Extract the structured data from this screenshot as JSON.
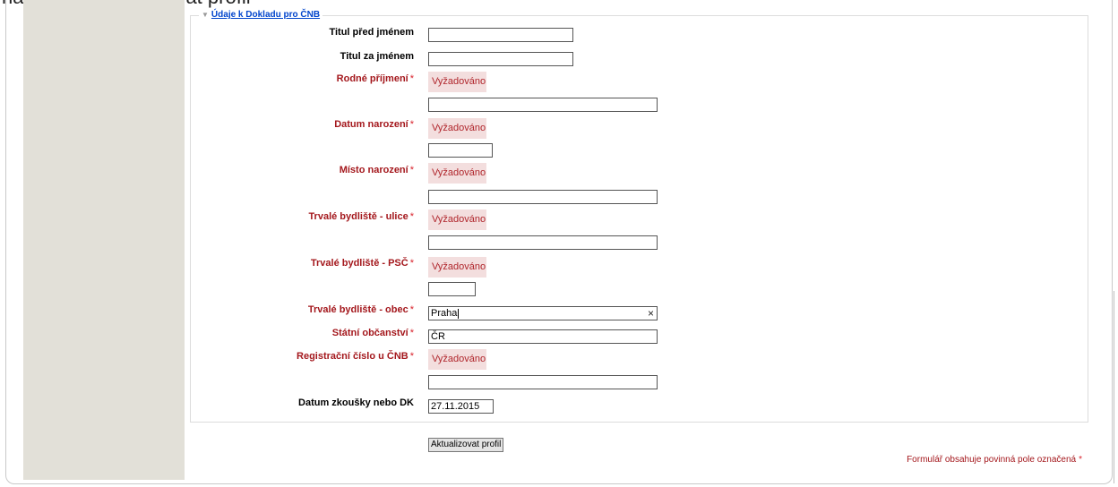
{
  "page": {
    "top_caption": "na tlačítko Aktualizovat profil"
  },
  "section": {
    "legend": "Údaje k Dokladu pro ČNB"
  },
  "required_badge": "Vyžadováno",
  "fields": [
    {
      "label": "Titul před jménem",
      "required": false,
      "value": ""
    },
    {
      "label": "Titul za jménem",
      "required": false,
      "value": ""
    },
    {
      "label": "Rodné příjmení",
      "required": true,
      "value": ""
    },
    {
      "label": "Datum narození",
      "required": true,
      "value": ""
    },
    {
      "label": "Místo narození",
      "required": true,
      "value": ""
    },
    {
      "label": "Trvalé bydliště - ulice",
      "required": true,
      "value": ""
    },
    {
      "label": "Trvalé bydliště - PSČ",
      "required": true,
      "value": ""
    },
    {
      "label": "Trvalé bydliště - obec",
      "required": true,
      "value": "Praha"
    },
    {
      "label": "Státní občanství",
      "required": true,
      "value": "ČR"
    },
    {
      "label": "Registrační číslo u ČNB",
      "required": true,
      "value": ""
    },
    {
      "label": "Datum zkoušky nebo DK",
      "required": false,
      "value": "27.11.2015"
    }
  ],
  "star": "*",
  "clear_symbol": "×",
  "submit_label": "Aktualizovat profil",
  "required_note": "Formulář obsahuje povinná pole označená",
  "colors": {
    "required_label": "#a4181d",
    "badge_bg": "#f3dede",
    "left_column": "#e2e0d8",
    "link": "#0044cc"
  }
}
